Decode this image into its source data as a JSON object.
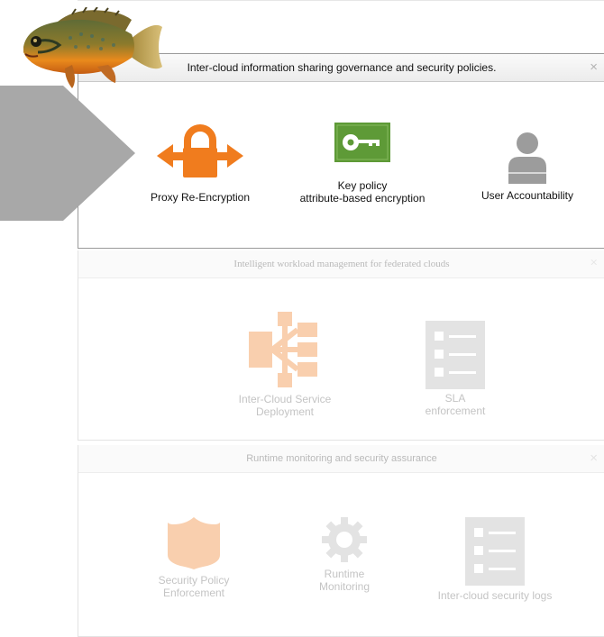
{
  "panels": [
    {
      "title": "Inter-cloud information sharing governance and security policies.",
      "close": "×",
      "items": [
        {
          "label": "Proxy Re-Encryption",
          "icon": "lock-arrows-icon"
        },
        {
          "label_line1": "Key policy",
          "label_line2": "attribute-based encryption",
          "icon": "key-icon"
        },
        {
          "label": "User Accountability",
          "icon": "user-icon"
        }
      ]
    },
    {
      "title": "Intelligent workload management for federated clouds",
      "close": "×",
      "items": [
        {
          "label_line1": "Inter-Cloud Service",
          "label_line2": "Deployment",
          "icon": "deployment-icon"
        },
        {
          "label_line1": "SLA",
          "label_line2": "enforcement",
          "icon": "checklist-icon"
        }
      ]
    },
    {
      "title": "Runtime monitoring and security  assurance",
      "close": "×",
      "items": [
        {
          "label_line1": "Security Policy",
          "label_line2": "Enforcement",
          "icon": "shield-icon"
        },
        {
          "label_line1": "Runtime",
          "label_line2": "Monitoring",
          "icon": "gear-icon"
        },
        {
          "label": "Inter-cloud security  logs",
          "icon": "log-list-icon"
        }
      ]
    }
  ],
  "colors": {
    "orange": "#f07c1e",
    "key_green": "#5e9a37",
    "user_gray": "#9c9c9c",
    "faded_orange": "#f9cfae",
    "faded_gray": "#e3e3e3",
    "pointer_gray": "#a8a8a8"
  }
}
